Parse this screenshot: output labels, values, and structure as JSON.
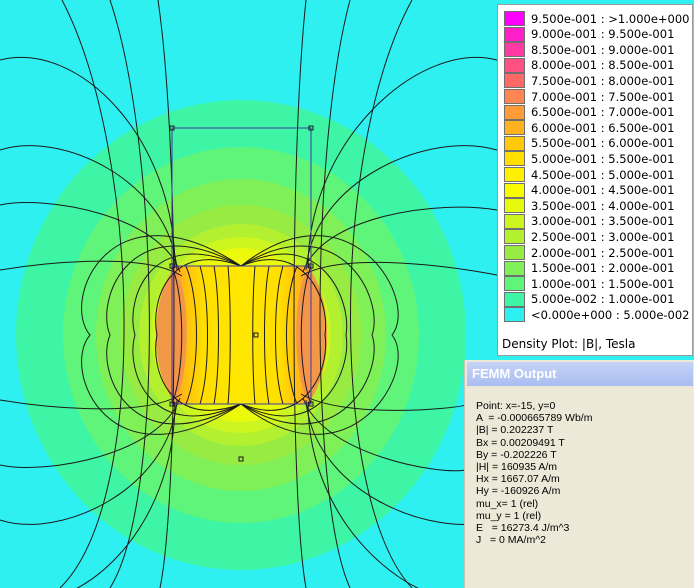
{
  "legend": {
    "entries": [
      {
        "label": "9.500e-001 : >1.000e+000",
        "color": "#ff00ff"
      },
      {
        "label": "9.000e-001 : 9.500e-001",
        "color": "#ff1fc8"
      },
      {
        "label": "8.500e-001 : 9.000e-001",
        "color": "#ff3aa3"
      },
      {
        "label": "8.000e-001 : 8.500e-001",
        "color": "#ff5283"
      },
      {
        "label": "7.500e-001 : 8.000e-001",
        "color": "#ff6a68"
      },
      {
        "label": "7.000e-001 : 7.500e-001",
        "color": "#ff8552"
      },
      {
        "label": "6.500e-001 : 7.000e-001",
        "color": "#ff9c3a"
      },
      {
        "label": "6.000e-001 : 6.500e-001",
        "color": "#ffb21f"
      },
      {
        "label": "5.500e-001 : 6.000e-001",
        "color": "#ffc80a"
      },
      {
        "label": "5.000e-001 : 5.500e-001",
        "color": "#ffde00"
      },
      {
        "label": "4.500e-001 : 5.000e-001",
        "color": "#ffef00"
      },
      {
        "label": "4.000e-001 : 4.500e-001",
        "color": "#fafa00"
      },
      {
        "label": "3.500e-001 : 4.000e-001",
        "color": "#e6fa10"
      },
      {
        "label": "3.000e-001 : 3.500e-001",
        "color": "#cdf520"
      },
      {
        "label": "2.500e-001 : 3.000e-001",
        "color": "#b2f030"
      },
      {
        "label": "2.000e-001 : 2.500e-001",
        "color": "#98eb42"
      },
      {
        "label": "1.500e-001 : 2.000e-001",
        "color": "#7ff058"
      },
      {
        "label": "1.000e-001 : 1.500e-001",
        "color": "#5ff57a"
      },
      {
        "label": "5.000e-002 : 1.000e-001",
        "color": "#3ef5a6"
      },
      {
        "label": "<0.000e+000 : 5.000e-002",
        "color": "#2ef0f0"
      }
    ],
    "title": "Density Plot: |B|, Tesla"
  },
  "output_window": {
    "title": "FEMM Output",
    "lines": [
      "Point: x=-15, y=0",
      "A  = -0.000665789 Wb/m",
      "|B| = 0.202237 T",
      "Bx = 0.00209491 T",
      "By = -0.202226 T",
      "|H| = 160935 A/m",
      "Hx = 1667.07 A/m",
      "Hy = -160926 A/m",
      "mu_x= 1 (rel)",
      "mu_y = 1 (rel)",
      "E   = 16273.4 J/m^3",
      "J   = 0 MA/m^2"
    ]
  },
  "colors": {
    "background": "#2ef0f0",
    "outline": "#3a3aa8",
    "flux_line": "#1a1a1a"
  }
}
